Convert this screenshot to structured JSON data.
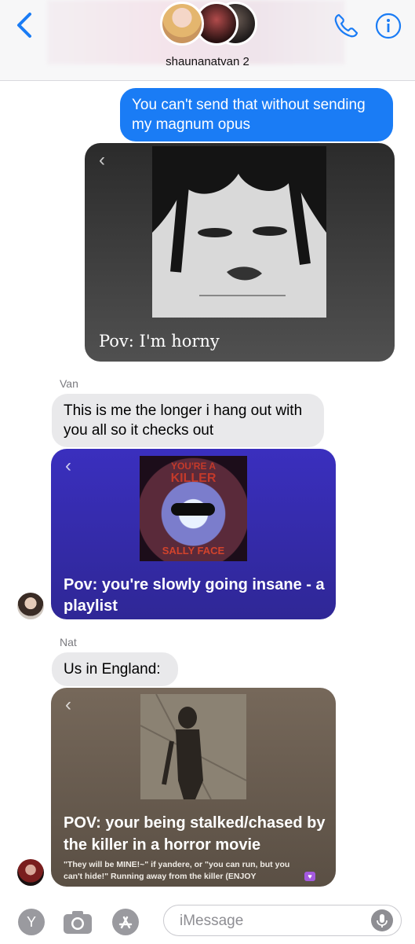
{
  "header": {
    "group_name": "shaunanatvan 2",
    "icons": [
      "back-chevron-icon",
      "phone-icon",
      "info-icon"
    ]
  },
  "messages": [
    {
      "type": "outgoing",
      "text": "You can't send that without sending my magnum opus"
    },
    {
      "type": "card",
      "caption": "Pov: I'm horny"
    },
    {
      "sender": "Van",
      "type": "incoming",
      "text": "This is me the longer i hang out with you all so it checks out"
    },
    {
      "type": "card",
      "title": "Pov: you're slowly going insane - a playlist",
      "art_text": [
        "YOU'RE A",
        "KILLER",
        "SALLY FACE"
      ]
    },
    {
      "sender": "Nat",
      "type": "incoming",
      "text": "Us in England:"
    },
    {
      "type": "card",
      "title": "POV: your being stalked/chased by the killer in a horror movie",
      "subtitle": "\"They will be MINE!~\" if yandere, or \"you can run, but you can't hide!\" Running away from the killer (ENJOY"
    }
  ],
  "composer": {
    "placeholder": "iMessage",
    "y_badge": "Y",
    "icons": [
      "camera-icon",
      "app-store-icon",
      "microphone-icon"
    ]
  },
  "colors": {
    "accent": "#1a7cf5",
    "incoming_bubble": "#e9e9eb",
    "playlist_card": "#3b2fb6"
  }
}
